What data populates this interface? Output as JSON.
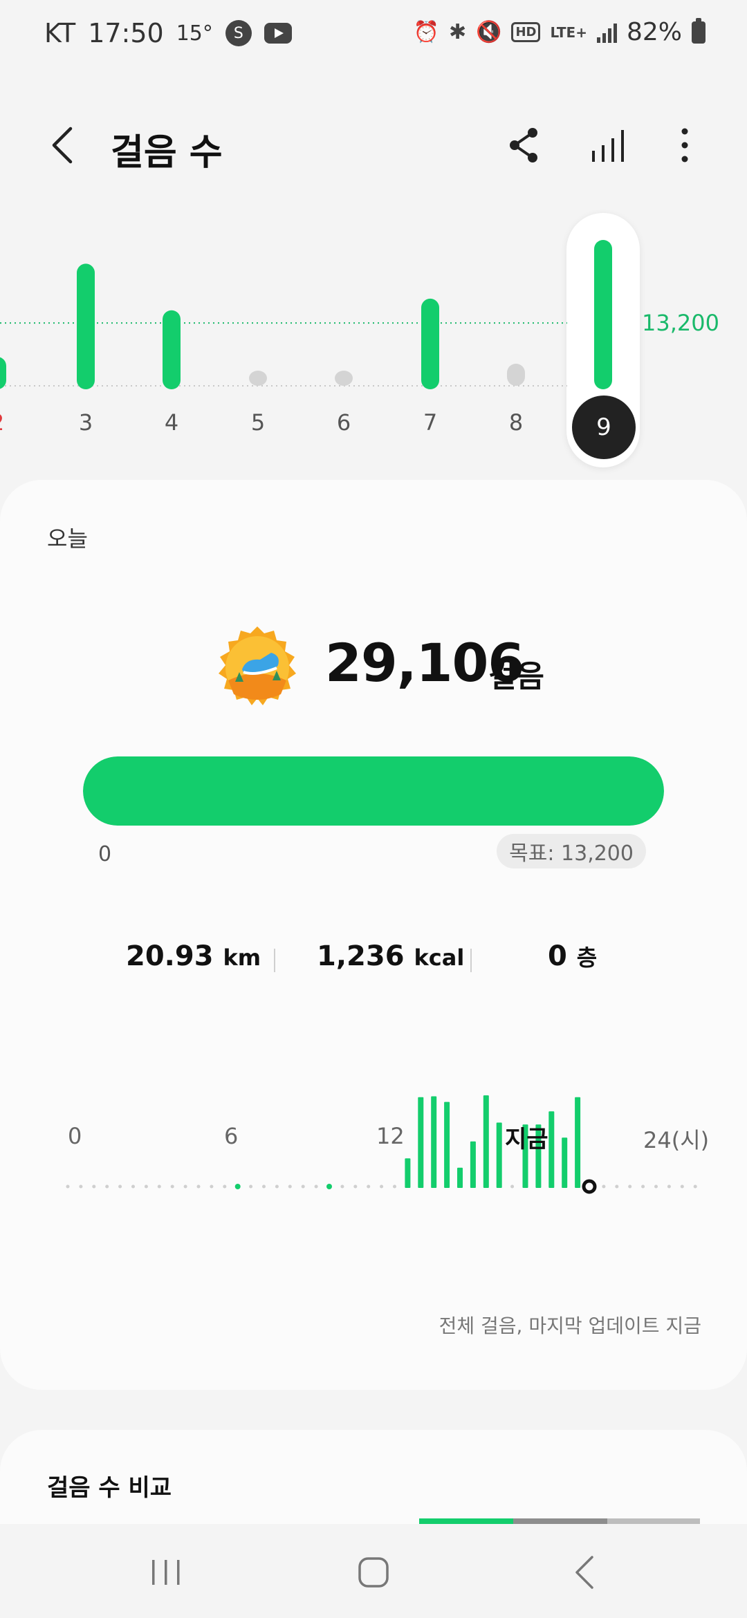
{
  "status": {
    "carrier": "KT",
    "time": "17:50",
    "temp": "15°",
    "network": "LTE+",
    "battery": "82%"
  },
  "header": {
    "title": "걸음 수"
  },
  "week": {
    "days": [
      "2",
      "3",
      "4",
      "5",
      "6",
      "7",
      "8",
      "9"
    ],
    "selected_day": "9",
    "goal_label": "13,200",
    "steps": [
      4000,
      24000,
      14000,
      0,
      0,
      16500,
      1200,
      29106
    ],
    "goal": 13200,
    "bar_color": "#13cd6c"
  },
  "today": {
    "label": "오늘",
    "steps": "29,106",
    "steps_unit": "걸음",
    "progress_fraction": 1.0,
    "progress_min": "0",
    "goal_text": "목표: 13,200",
    "distance": "20.93",
    "distance_unit": "km",
    "calories": "1,236",
    "calories_unit": "kcal",
    "floors": "0",
    "floors_unit": "층"
  },
  "hourly": {
    "axis": [
      "0",
      "6",
      "12",
      "지금",
      "24(시)"
    ],
    "footnote": "전체 걸음, 마지막 업데이트 지금",
    "bars": [
      {
        "slot": 26,
        "value": 30
      },
      {
        "slot": 27,
        "value": 95
      },
      {
        "slot": 28,
        "value": 96
      },
      {
        "slot": 29,
        "value": 90
      },
      {
        "slot": 30,
        "value": 20
      },
      {
        "slot": 31,
        "value": 48
      },
      {
        "slot": 32,
        "value": 97
      },
      {
        "slot": 33,
        "value": 68
      },
      {
        "slot": 35,
        "value": 66
      },
      {
        "slot": 36,
        "value": 66
      },
      {
        "slot": 37,
        "value": 80
      },
      {
        "slot": 38,
        "value": 52
      },
      {
        "slot": 39,
        "value": 95
      }
    ],
    "dot_slots": [
      13,
      20
    ]
  },
  "compare": {
    "title": "걸음 수 비교"
  },
  "colors": {
    "accent": "#13cd6c",
    "goal_text": "#19b96a",
    "sunday": "#e0393c"
  }
}
